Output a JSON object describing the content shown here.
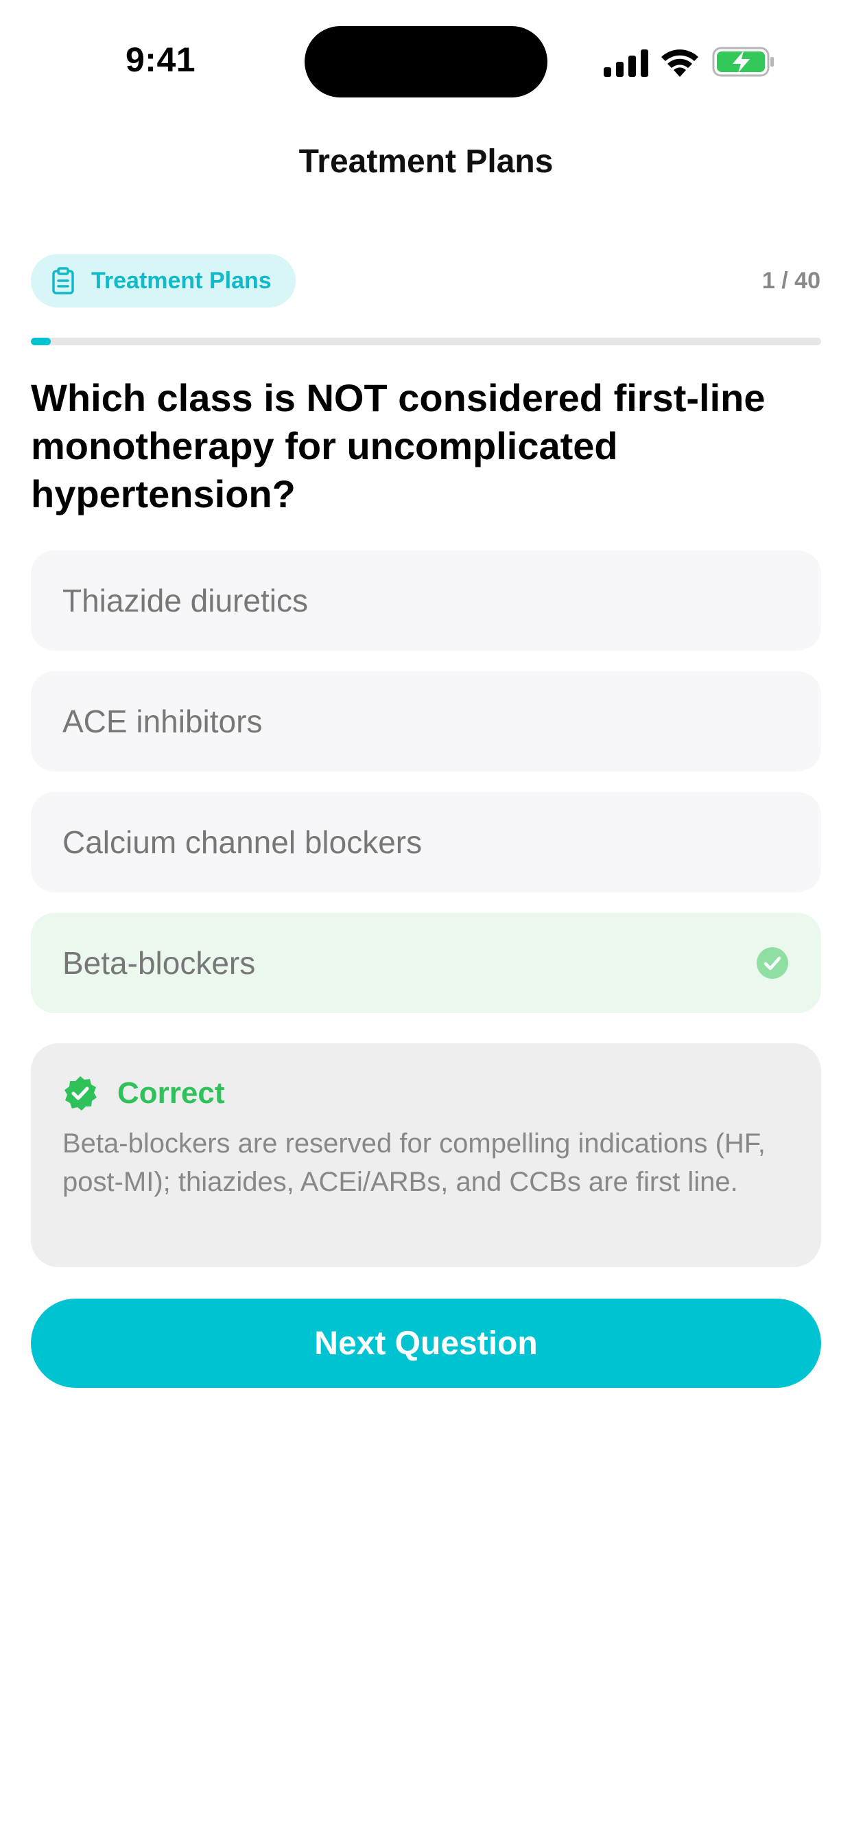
{
  "status_bar": {
    "time": "9:41"
  },
  "nav": {
    "title": "Treatment Plans"
  },
  "header": {
    "category_chip": "Treatment Plans",
    "counter": "1 / 40",
    "progress": 0.025
  },
  "question": {
    "text": "Which class is NOT considered first-line monotherapy for uncomplicated hypertension?"
  },
  "options": [
    {
      "label": "Thiazide diuretics"
    },
    {
      "label": "ACE inhibitors"
    },
    {
      "label": "Calcium channel blockers"
    },
    {
      "label": "Beta-blockers",
      "state": "correct"
    }
  ],
  "feedback": {
    "title": "Correct",
    "text": "Beta-blockers are reserved for compelling indications (HF, post-MI); thiazides, ACEi/ARBs, and CCBs are first line."
  },
  "next_button": {
    "label": "Next Question"
  },
  "colors": {
    "accent": "#00c3d2",
    "chip_bg": "#d8f6f8",
    "correct_green": "#2fc25b",
    "correct_bg": "#ebf8ed",
    "battery_green": "#34c759"
  },
  "icons": {
    "signal": "cellular-signal-icon",
    "wifi": "wifi-icon",
    "battery": "battery-charging-icon",
    "chip": "clipboard-icon",
    "option_check": "check-circle-icon",
    "feedback": "verified-badge-icon"
  }
}
